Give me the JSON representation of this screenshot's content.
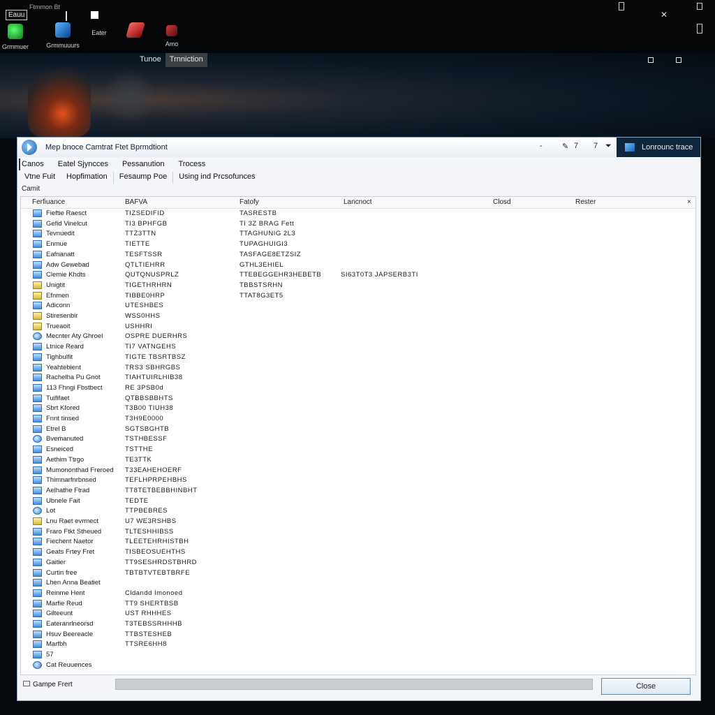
{
  "desktop": {
    "app_label": "Eauu",
    "sub_label": "Ftmmon Bt",
    "icons": [
      {
        "label": "Grmmuer",
        "icon": "green-shield-icon"
      },
      {
        "label": "Grmmuuurs",
        "icon": "blue-shield-icon"
      },
      {
        "label": "Eater",
        "icon": "red-tool-icon"
      },
      {
        "label": "Amo",
        "icon": "red-app-icon"
      }
    ]
  },
  "hero": {
    "tabs": [
      "Tunoe",
      "Trnniction"
    ]
  },
  "window": {
    "title": "Mep bnoce Camtrat Ftet Bprmdtiont",
    "controls": [
      "-",
      "7",
      "7"
    ],
    "action_label": "Lonrounc trace",
    "menus": [
      "Canos",
      "Eatel Sjyncces",
      "Pessanution",
      "Trocess"
    ],
    "submenus": [
      "Vtne Fuit",
      "Hopfimation",
      "Fesaump Poe",
      "Using ind Prcsofunces"
    ],
    "caption": "Camit",
    "columns": [
      "Ferfiuance",
      "BAFVA",
      "Fatofy",
      "Lancnoct",
      "Closd",
      "Rester"
    ],
    "close_x": "×"
  },
  "rows": [
    {
      "name": "Fieftie Raesct",
      "c2": "TIZSEDIFID",
      "c3": "TASRESTB",
      "c4": "",
      "icon": "app"
    },
    {
      "name": "Gefid Vinelcut",
      "c2": "TI3 BPHFGB",
      "c3": "TI 3Z BRAG Fett",
      "c4": "",
      "icon": "app"
    },
    {
      "name": "Tevnuedit",
      "c2": "TTZ3TTN",
      "c3": "TTAGHUNIG 2L3",
      "c4": "",
      "icon": "app"
    },
    {
      "name": "Enmue",
      "c2": "TIETTE",
      "c3": "TUPAGHUIGI3",
      "c4": "",
      "icon": "app"
    },
    {
      "name": "Eafnanatt",
      "c2": "TESFTSSR",
      "c3": "TASFAGE8ETZSIZ",
      "c4": "",
      "icon": "app"
    },
    {
      "name": "Adw Gewebad",
      "c2": "QTLTIEHRR",
      "c3": "GTHL3EHIEL",
      "c4": "",
      "icon": "app"
    },
    {
      "name": "Clemie Khdts",
      "c2": "QUTQNUSPRLZ",
      "c3": "TTEBEGGEHR3HEBETB",
      "c4": "SI63T0T3 JAPSERB3TI",
      "icon": "app"
    },
    {
      "name": "Unigtit",
      "c2": "TIGETHRHRN",
      "c3": "TBBSTSRHN",
      "c4": "",
      "icon": "folder"
    },
    {
      "name": "Efnmen",
      "c2": "TIBBE0HRP",
      "c3": "TTAT8G3ET5",
      "c4": "",
      "icon": "folder"
    },
    {
      "name": "Adiconn",
      "c2": "UTESHBES",
      "c3": "",
      "c4": "",
      "icon": "app"
    },
    {
      "name": "Stiresenbir",
      "c2": "WSS0HHS",
      "c3": "",
      "c4": "",
      "icon": "folder"
    },
    {
      "name": "Trueaoit",
      "c2": "USHHRI",
      "c3": "",
      "c4": "",
      "icon": "folder"
    },
    {
      "name": "Mecnter Aty Ghroel",
      "c2": "OSPRE DUERHRS",
      "c3": "",
      "c4": "",
      "icon": "globe"
    },
    {
      "name": "Ltnice Reard",
      "c2": "TI7 VATNGEHS",
      "c3": "",
      "c4": "",
      "icon": "app"
    },
    {
      "name": "Tighbulfit",
      "c2": "TIGTE TBSRTBSZ",
      "c3": "",
      "c4": "",
      "icon": "app"
    },
    {
      "name": "Yeahtebient",
      "c2": "TRS3 SBHRGBS",
      "c3": "",
      "c4": "",
      "icon": "app"
    },
    {
      "name": "Rachelha Pu Gnot",
      "c2": "TIAHTUIRLHIB38",
      "c3": "",
      "c4": "",
      "icon": "app"
    },
    {
      "name": "113 Fhngi Fbstbect",
      "c2": "RE 3PSB0d",
      "c3": "",
      "c4": "",
      "icon": "app"
    },
    {
      "name": "Tuififaet",
      "c2": "QTBBSBBHTS",
      "c3": "",
      "c4": "",
      "icon": "app"
    },
    {
      "name": "Sbrt Kfored",
      "c2": "T3B00 TIUH38",
      "c3": "",
      "c4": "",
      "icon": "app"
    },
    {
      "name": "Fnnt tinsed",
      "c2": "T3H9E0000",
      "c3": "",
      "c4": "",
      "icon": "app"
    },
    {
      "name": "Etrel B",
      "c2": "SGTSBGHTB",
      "c3": "",
      "c4": "",
      "icon": "app"
    },
    {
      "name": "Bvemanuted",
      "c2": "TSTHBESSF",
      "c3": "",
      "c4": "",
      "icon": "globe"
    },
    {
      "name": "Esneiced",
      "c2": "TSTTHE",
      "c3": "",
      "c4": "",
      "icon": "app"
    },
    {
      "name": "Aethim Ttrgo",
      "c2": "TE3TTK",
      "c3": "",
      "c4": "",
      "icon": "app"
    },
    {
      "name": "Mumononthad Freroed",
      "c2": "T33EAHEHOERF",
      "c3": "",
      "c4": "",
      "icon": "app"
    },
    {
      "name": "Thimnarfnrbnsed",
      "c2": "TEFLHPRPEHBHS",
      "c3": "",
      "c4": "",
      "icon": "app"
    },
    {
      "name": "Aelhathe Ftrad",
      "c2": "TT8TETBEBBHINBHT",
      "c3": "",
      "c4": "",
      "icon": "app"
    },
    {
      "name": "Ubnele Fait",
      "c2": "TEDTE",
      "c3": "",
      "c4": "",
      "icon": "app"
    },
    {
      "name": "Lot",
      "c2": "TTPBEBRES",
      "c3": "",
      "c4": "",
      "icon": "globe"
    },
    {
      "name": "Lnu Raet evrmect",
      "c2": "U7 WE3RSHBS",
      "c3": "",
      "c4": "",
      "icon": "folder"
    },
    {
      "name": "Fraro Ftkt Stheued",
      "c2": "TLTESHHIBSS",
      "c3": "",
      "c4": "",
      "icon": "app"
    },
    {
      "name": "Fiechent Naetor",
      "c2": "TLEETEHRHISTBH",
      "c3": "",
      "c4": "",
      "icon": "app"
    },
    {
      "name": "Geats Frtey Fret",
      "c2": "TISBEOSUEHTHS",
      "c3": "",
      "c4": "",
      "icon": "app"
    },
    {
      "name": "Gaitier",
      "c2": "TT9SESHRDSTBHRD",
      "c3": "",
      "c4": "",
      "icon": "app"
    },
    {
      "name": "Curtin free",
      "c2": "TBTBTVTEBTBRFE",
      "c3": "",
      "c4": "",
      "icon": "app"
    },
    {
      "name": "Lhen Anna Beatiet",
      "c2": "",
      "c3": "",
      "c4": "",
      "icon": "app"
    },
    {
      "name": "Reinme Hent",
      "c2": "Cldandd Imonoed",
      "c3": "",
      "c4": "",
      "icon": "app"
    },
    {
      "name": "Marfie Reud",
      "c2": "TT9 SHERTBSB",
      "c3": "",
      "c4": "",
      "icon": "app"
    },
    {
      "name": "Gilteeunt",
      "c2": "UST RHHHES",
      "c3": "",
      "c4": "",
      "icon": "app"
    },
    {
      "name": "Eateranrlneorsd",
      "c2": "T3TEBSSRHHHB",
      "c3": "",
      "c4": "",
      "icon": "app"
    },
    {
      "name": "Hsuv Beereacle",
      "c2": "TTBSTESHEB",
      "c3": "",
      "c4": "",
      "icon": "app"
    },
    {
      "name": "Marfbh",
      "c2": "TTSRE6HH8",
      "c3": "",
      "c4": "",
      "icon": "app"
    },
    {
      "name": "57",
      "c2": "",
      "c3": "",
      "c4": "",
      "icon": "app"
    },
    {
      "name": "Cat Reuuences",
      "c2": "",
      "c3": "",
      "c4": "",
      "icon": "globe"
    }
  ],
  "footer": {
    "link_label": "Gampe Frert",
    "progress": 0,
    "close_label": "Close"
  }
}
